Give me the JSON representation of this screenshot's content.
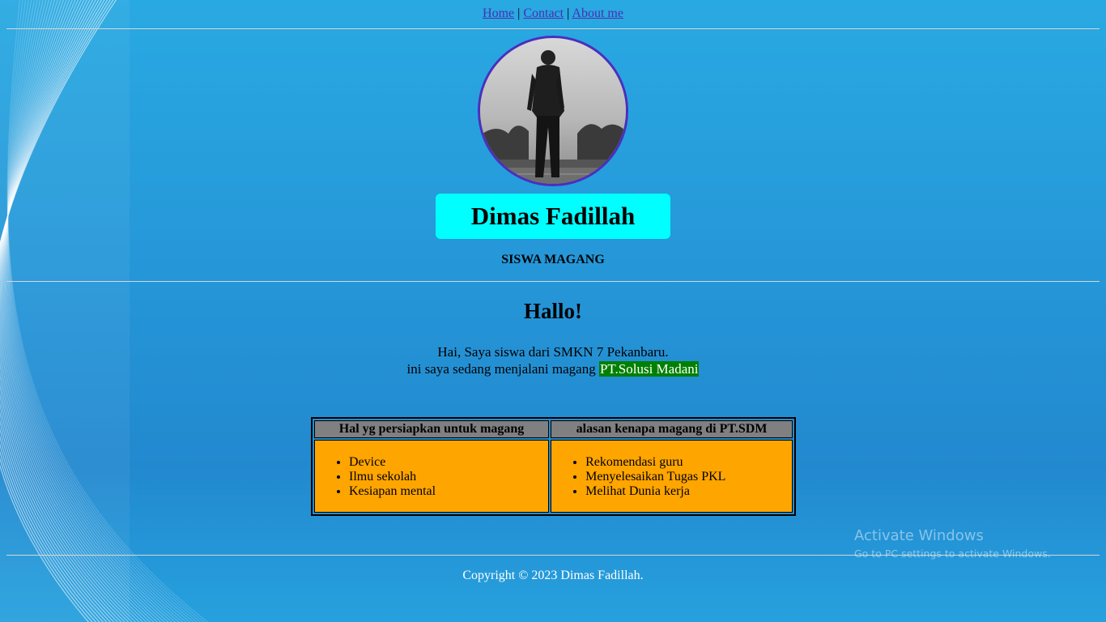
{
  "nav": {
    "home": "Home",
    "separator": "|",
    "contact": "Contact",
    "about": "About me"
  },
  "profile": {
    "name": "Dimas Fadillah",
    "role": "SISWA MAGANG"
  },
  "greeting": {
    "title": "Hallo!",
    "line1": "Hai, Saya siswa dari SMKN 7 Pekanbaru.",
    "line2_prefix": "ini saya sedang menjalani magang ",
    "company": "PT.Solusi Madani"
  },
  "table": {
    "headers": [
      "Hal yg persiapkan untuk magang",
      "alasan kenapa magang di PT.SDM"
    ],
    "col1_items": [
      "Device",
      "Ilmu sekolah",
      "Kesiapan mental"
    ],
    "col2_items": [
      "Rekomendasi guru",
      "Menyelesaikan Tugas PKL",
      "Melihat Dunia kerja"
    ]
  },
  "footer": {
    "copyright": "Copyright © 2023 Dimas Fadillah."
  },
  "watermark": {
    "title": "Activate Windows",
    "subtitle": "Go to PC settings to activate Windows."
  },
  "colors": {
    "background": "#2596d8",
    "name_box": "#00ffff",
    "highlight": "#008000",
    "table_header": "#808080",
    "table_cell": "#ffa500",
    "avatar_border": "#4a2fbf"
  }
}
